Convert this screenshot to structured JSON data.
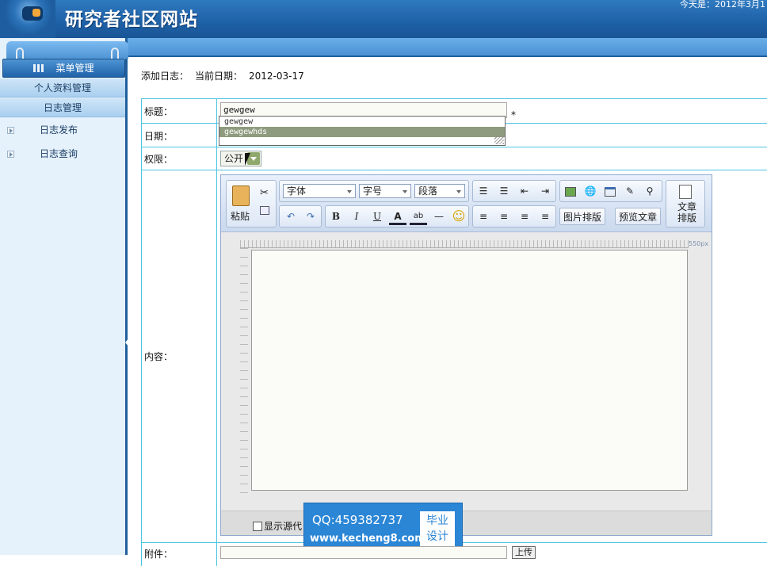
{
  "header": {
    "site_title": "研究者社区网站",
    "today": "今天是：2012年3月1"
  },
  "sidebar": {
    "menu_title": "菜单管理",
    "sections": [
      "个人资料管理",
      "日志管理"
    ],
    "items": [
      {
        "label": "日志发布"
      },
      {
        "label": "日志查询"
      }
    ]
  },
  "page": {
    "crumb_title": "添加日志：",
    "date_label": "当前日期：",
    "current_date": "2012-03-17"
  },
  "form": {
    "title_label": "标题：",
    "title_value": "gewgew",
    "required_mark": "*",
    "autocomplete": [
      "gewgew",
      "gewgewhds"
    ],
    "date_label": "日期：",
    "permission_label": "权限：",
    "permission_value": "公开",
    "content_label": "内容：",
    "attachment_label": "附件：",
    "upload_button": "上传"
  },
  "editor": {
    "paste": "粘贴",
    "font": "字体",
    "font_size": "字号",
    "paragraph": "段落",
    "image_layout": "图片排版",
    "preview": "预览文章",
    "article_layout": "文章排版",
    "ruler_label": "550px",
    "show_source": "显示源代"
  },
  "watermark": {
    "qq": "QQ:459382737",
    "site": "www.kecheng8.com",
    "stamp": "毕业设计"
  }
}
